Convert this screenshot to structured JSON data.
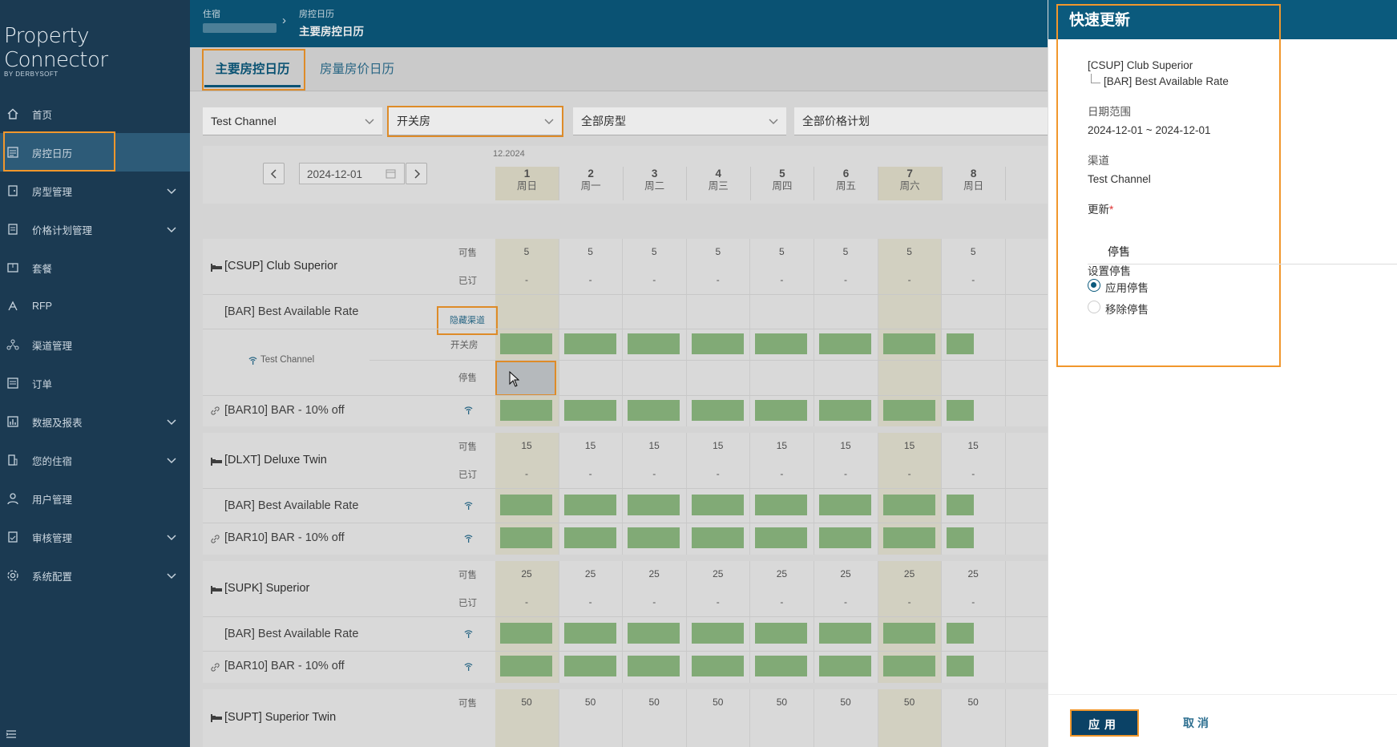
{
  "app": {
    "brand": "Property Connector",
    "brand_sub": "BY DERBYSOFT"
  },
  "sidebar": {
    "items": [
      {
        "label": "首页",
        "icon": "home-icon"
      },
      {
        "label": "房控日历",
        "icon": "calendar-icon"
      },
      {
        "label": "房型管理",
        "icon": "room-type-icon"
      },
      {
        "label": "价格计划管理",
        "icon": "rate-plan-icon"
      },
      {
        "label": "套餐",
        "icon": "package-icon"
      },
      {
        "label": "RFP",
        "icon": "rfp-icon"
      },
      {
        "label": "渠道管理",
        "icon": "channel-icon"
      },
      {
        "label": "订单",
        "icon": "order-icon"
      },
      {
        "label": "数据及报表",
        "icon": "report-icon"
      },
      {
        "label": "您的住宿",
        "icon": "building-icon"
      },
      {
        "label": "用户管理",
        "icon": "user-icon"
      },
      {
        "label": "审核管理",
        "icon": "audit-icon"
      },
      {
        "label": "系统配置",
        "icon": "settings-icon"
      }
    ]
  },
  "header": {
    "breadcrumb_1": "住宿",
    "breadcrumb_2": "房控日历",
    "page_title": "主要房控日历"
  },
  "tabs": [
    "主要房控日历",
    "房量房价日历"
  ],
  "filters": {
    "channel": "Test Channel",
    "type": "开关房",
    "room_type": "全部房型",
    "rate_plan": "全部价格计划"
  },
  "calendar": {
    "date": "2024-12-01",
    "month": "12.2024",
    "days": [
      {
        "n": "1",
        "w": "周日"
      },
      {
        "n": "2",
        "w": "周一"
      },
      {
        "n": "3",
        "w": "周二"
      },
      {
        "n": "4",
        "w": "周三"
      },
      {
        "n": "5",
        "w": "周四"
      },
      {
        "n": "6",
        "w": "周五"
      },
      {
        "n": "7",
        "w": "周六"
      },
      {
        "n": "8",
        "w": "周日"
      }
    ],
    "labels": {
      "available": "可售",
      "booked": "已订",
      "open_close": "开关房",
      "stop_sell": "停售",
      "hide_channel": "隐藏渠道",
      "dash": "-"
    },
    "rooms": [
      {
        "name": "[CSUP] Club Superior",
        "avail": "5",
        "rate1": "[BAR] Best Available Rate",
        "rate2": "[BAR10] BAR - 10% off",
        "channel": "Test Channel"
      },
      {
        "name": "[DLXT] Deluxe Twin",
        "avail": "15",
        "rate1": "[BAR] Best Available Rate",
        "rate2": "[BAR10] BAR - 10% off"
      },
      {
        "name": "[SUPK] Superior",
        "avail": "25",
        "rate1": "[BAR] Best Available Rate",
        "rate2": "[BAR10] BAR - 10% off"
      },
      {
        "name": "[SUPT] Superior Twin",
        "avail": "50"
      }
    ]
  },
  "panel": {
    "title": "快速更新",
    "room": "[CSUP] Club Superior",
    "rate": "[BAR] Best Available Rate",
    "date_range_label": "日期范围",
    "date_range": "2024-12-01 ~ 2024-12-01",
    "channel_label": "渠道",
    "channel": "Test Channel",
    "update_label": "更新",
    "required_mark": "*",
    "update_value": "停售",
    "stop_label": "设置停售",
    "apply_stop": "应用停售",
    "remove_stop": "移除停售",
    "apply_btn": "应用",
    "cancel_btn": "取消"
  },
  "colors": {
    "sidebar": "#1b3a52",
    "topbar": "#0b5a7d",
    "accent": "#f1972c",
    "open": "#8cb981"
  }
}
